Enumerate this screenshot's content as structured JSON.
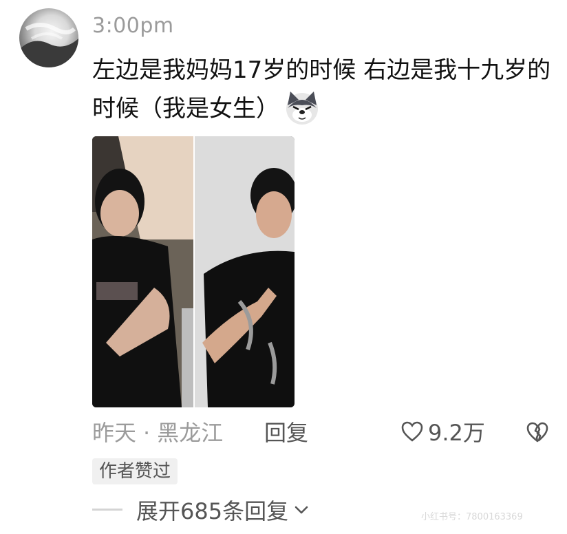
{
  "comment": {
    "time": "3:00pm",
    "text": "左边是我妈妈17岁的时候 右边是我十九岁的时候（我是女生）",
    "emoji": "wolf-face-emoji",
    "meta": {
      "date": "昨天",
      "separator": "·",
      "location": "黑龙江"
    },
    "reply_label": "回复",
    "like_count": "9.2万",
    "author_badge": "作者赞过",
    "expand_label": "展开685条回复"
  },
  "watermark": "小红书号：7800163369",
  "colors": {
    "primary_text": "#111111",
    "secondary_text": "#9b9b9b",
    "action_text": "#555555",
    "badge_bg": "#f0f0f0"
  }
}
